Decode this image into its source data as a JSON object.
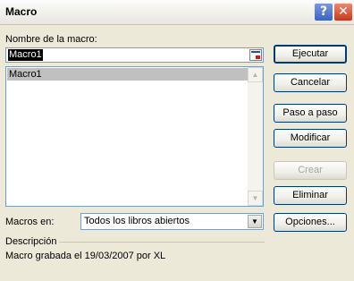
{
  "window": {
    "title": "Macro",
    "help_label": "?",
    "close_label": "✕"
  },
  "macro_name": {
    "label": "Nombre de la macro:",
    "value": "Macro1"
  },
  "macro_list": {
    "items": [
      "Macro1"
    ],
    "selected_index": 0
  },
  "macros_in": {
    "label": "Macros en:",
    "value": "Todos los libros abiertos"
  },
  "description": {
    "label": "Descripción",
    "text": "Macro grabada el 19/03/2007 por XL"
  },
  "buttons": {
    "run": "Ejecutar",
    "cancel": "Cancelar",
    "step_into": "Paso a paso",
    "edit": "Modificar",
    "create": "Crear",
    "delete": "Eliminar",
    "options": "Opciones..."
  },
  "icons": {
    "help": "help-icon",
    "close": "close-icon",
    "collapse": "collapse-dialog-icon",
    "scroll_up": "scroll-up-icon",
    "scroll_down": "scroll-down-icon",
    "dropdown": "chevron-down-icon"
  }
}
